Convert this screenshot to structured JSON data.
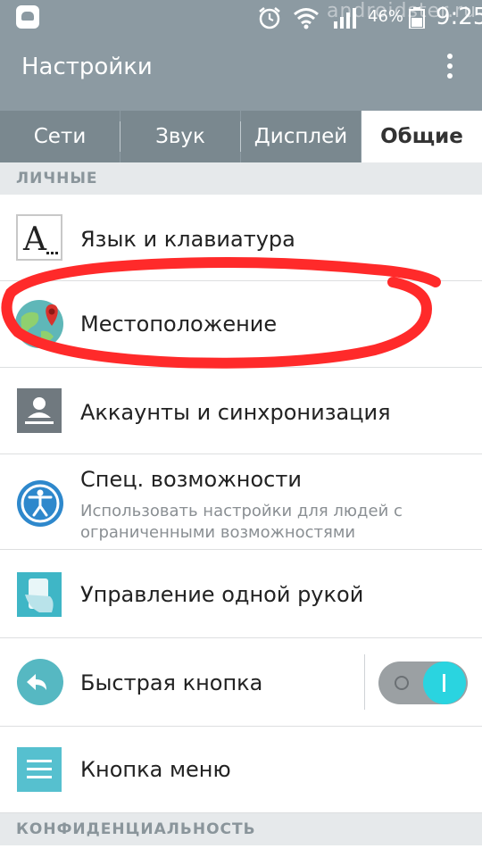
{
  "status_bar": {
    "battery": "46%",
    "time": "9:25",
    "watermark": "androidster.ru"
  },
  "app_bar": {
    "title": "Настройки"
  },
  "tabs": [
    {
      "label": "Сети",
      "active": false
    },
    {
      "label": "Звук",
      "active": false
    },
    {
      "label": "Дисплей",
      "active": false
    },
    {
      "label": "Общие",
      "active": true
    }
  ],
  "sections": {
    "personal": "ЛИЧНЫЕ",
    "privacy": "КОНФИДЕНЦИАЛЬНОСТЬ"
  },
  "items": [
    {
      "label": "Язык и клавиатура",
      "icon": "language-keyboard-icon"
    },
    {
      "label": "Местоположение",
      "icon": "location-icon"
    },
    {
      "label": "Аккаунты и синхронизация",
      "icon": "accounts-sync-icon"
    },
    {
      "label": "Спец. возможности",
      "subtitle": "Использовать настройки для людей с ограниченными возможностями",
      "icon": "accessibility-icon"
    },
    {
      "label": "Управление одной рукой",
      "icon": "one-hand-icon"
    },
    {
      "label": "Быстрая кнопка",
      "icon": "quick-button-icon",
      "toggle": true
    },
    {
      "label": "Кнопка меню",
      "icon": "menu-button-icon"
    }
  ],
  "colors": {
    "header": "#8c9aa2",
    "accent_toggle": "#2ad4e0",
    "annotation": "#ff2a2a"
  }
}
